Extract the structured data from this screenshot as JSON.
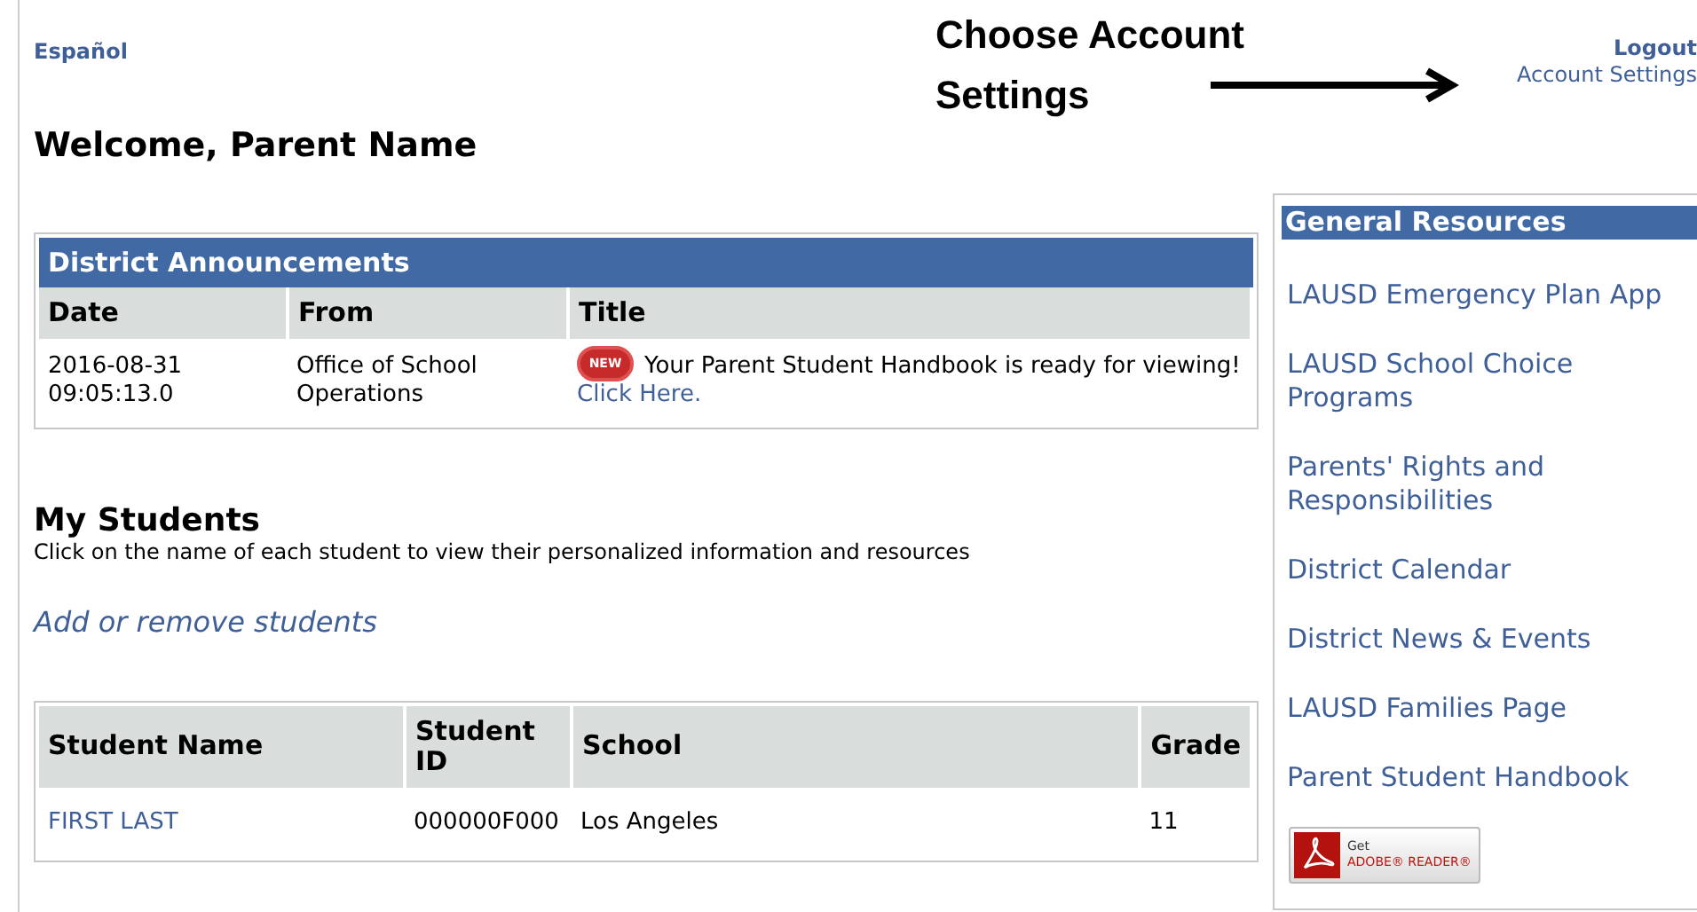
{
  "language_link": "Español",
  "account_links": [
    "Logout",
    "Account Settings"
  ],
  "annotation": {
    "text": "Choose Account Settings"
  },
  "welcome": "Welcome, Parent Name",
  "announcements": {
    "title": "District Announcements",
    "columns": [
      "Date",
      "From",
      "Title"
    ],
    "rows": [
      {
        "date": "2016-08-31 09:05:13.0",
        "from": "Office of School Operations",
        "badge": "NEW",
        "title": "Your Parent Student Handbook is ready for viewing!",
        "link": "Click Here."
      }
    ]
  },
  "students": {
    "title": "My Students",
    "description": "Click on the name of each student to view their personalized information and resources",
    "manage_link": "Add or remove students",
    "columns": [
      "Student Name",
      "Student ID",
      "School",
      "Grade"
    ],
    "rows": [
      {
        "name": "FIRST LAST",
        "id": "000000F000",
        "school": "Los Angeles",
        "grade": "11"
      }
    ]
  },
  "resources": {
    "title": "General Resources",
    "links": [
      "LAUSD Emergency Plan App",
      "LAUSD School Choice Programs",
      "Parents' Rights and Responsibilities",
      "District Calendar",
      "District News & Events",
      "LAUSD Families Page",
      "Parent Student Handbook"
    ],
    "badge": {
      "line_1": "Get",
      "line_2": "ADOBE® READER®"
    }
  }
}
